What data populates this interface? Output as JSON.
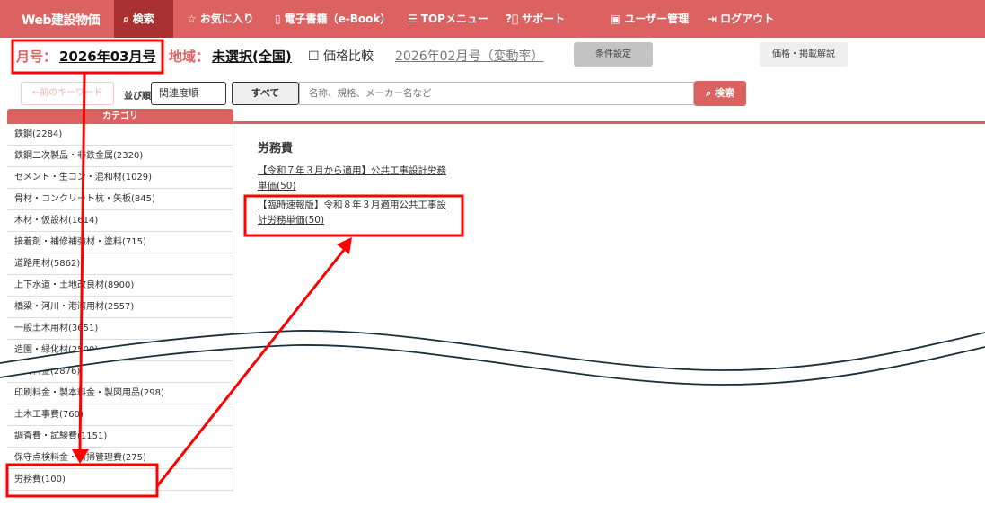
{
  "nav": {
    "logo": "Web建設物価",
    "items": [
      {
        "label": "検索",
        "icon": "search-icon",
        "active": true
      },
      {
        "label": "お気に入り",
        "icon": "star-icon"
      },
      {
        "label": "電子書籍（e-Book）",
        "icon": "book-icon"
      },
      {
        "label": "TOPメニュー",
        "icon": "menu-icon"
      },
      {
        "label": "サポート",
        "icon": "help-icon"
      },
      {
        "label": "ユーザー管理",
        "icon": "user-icon"
      },
      {
        "label": "ログアウト",
        "icon": "logout-icon"
      }
    ],
    "color": "#dc6262",
    "active_color": "#a93131"
  },
  "conditions": {
    "month_label": "月号：",
    "month_value": "2026年03月号",
    "region_label": "地域：",
    "region_value": "未選択(全国)",
    "compare_label": "価格比較",
    "compare_checked": false,
    "compare_value": "2026年02月号（変動率）",
    "settings_button": "条件設定",
    "explain_button": "価格・掲載解説"
  },
  "search": {
    "prev_keyword": "←前のキーワード",
    "sort_label": "並び順",
    "sort_value": "関連度順",
    "scope": "すべて",
    "placeholder": "名称、規格、メーカー名など",
    "button": "検索"
  },
  "sidebar": {
    "header": "カテゴリ",
    "items_top": [
      "鉄鋼(2284)",
      "鉄鋼二次製品・非鉄金属(2320)",
      "セメント・生コン・混和材(1029)",
      "骨材・コンクリート杭・矢板(845)",
      "木材・仮設材(1614)",
      "接着剤・補修補強材・塗料(715)",
      "道路用材(5862)",
      "上下水道・土地改良材(8900)",
      "橋梁・河川・港湾用材(2557)",
      "一般土木用材(3651)",
      "造園・緑化材(2500)"
    ],
    "items_bottom": [
      "賃貸料金(2876)",
      "印刷料金・製本料金・製図用品(298)",
      "土木工事費(760)",
      "調査費・試験費(1151)",
      "保守点検料金・清掃管理費(275)",
      "労務費(100)"
    ]
  },
  "main": {
    "title": "労務費",
    "links": [
      "【令和７年３月から適用】公共工事設計労務単価(50)",
      "【臨時速報版】令和８年３月適用公共工事設計労務単価(50)"
    ]
  },
  "annotation_color": "#ff0000"
}
